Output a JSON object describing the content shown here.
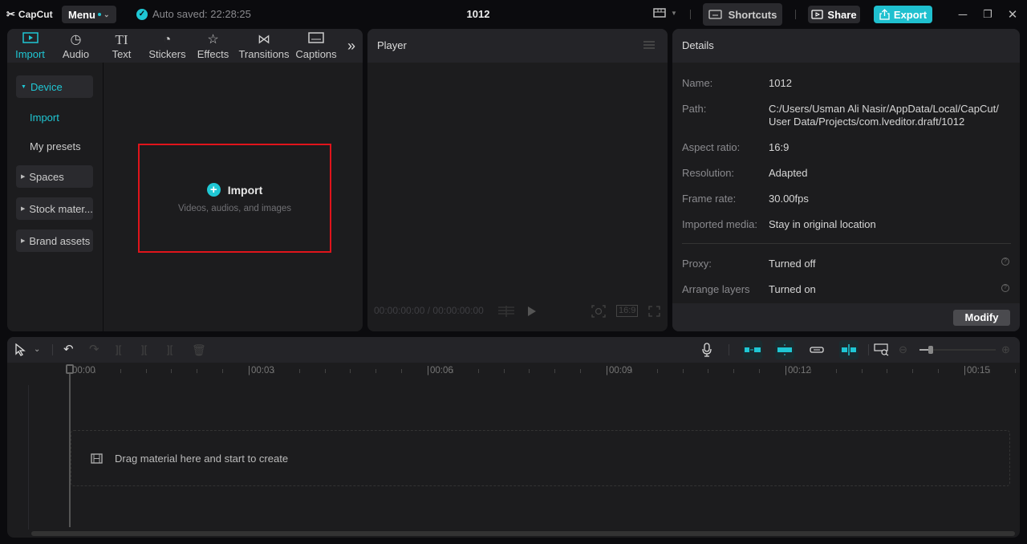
{
  "app": {
    "logo_text": "CapCut",
    "menu_label": "Menu",
    "autosave_text": "Auto saved: 22:28:25",
    "project_title": "1012",
    "shortcuts_label": "Shortcuts",
    "share_label": "Share",
    "export_label": "Export",
    "accent_color": "#1fc7d4"
  },
  "media_tabs": [
    {
      "label": "Import",
      "icon": "import-icon",
      "active": true
    },
    {
      "label": "Audio",
      "icon": "audio-icon"
    },
    {
      "label": "Text",
      "icon": "text-icon",
      "glyph": "TI"
    },
    {
      "label": "Stickers",
      "icon": "stickers-icon"
    },
    {
      "label": "Effects",
      "icon": "effects-icon"
    },
    {
      "label": "Transitions",
      "icon": "transitions-icon"
    },
    {
      "label": "Captions",
      "icon": "captions-icon"
    }
  ],
  "sidebar": {
    "device": "Device",
    "import": "Import",
    "my_presets": "My presets",
    "spaces": "Spaces",
    "stock": "Stock mater...",
    "brand": "Brand assets"
  },
  "import_box": {
    "title": "Import",
    "subtitle": "Videos, audios, and images"
  },
  "player": {
    "title": "Player",
    "time": "00:00:00:00 / 00:00:00:00",
    "ratio": "16:9"
  },
  "details": {
    "title": "Details",
    "rows": [
      {
        "label": "Name:",
        "value": "1012"
      },
      {
        "label": "Path:",
        "value": "C:/Users/Usman Ali Nasir/AppData/Local/CapCut/ User Data/Projects/com.lveditor.draft/1012"
      },
      {
        "label": "Aspect ratio:",
        "value": "16:9"
      },
      {
        "label": "Resolution:",
        "value": "Adapted"
      },
      {
        "label": "Frame rate:",
        "value": "30.00fps"
      },
      {
        "label": "Imported media:",
        "value": "Stay in original location"
      },
      {
        "label": "Proxy:",
        "value": "Turned off"
      },
      {
        "label": "Arrange layers",
        "value": "Turned on"
      }
    ],
    "modify_label": "Modify"
  },
  "timeline": {
    "ruler_labels": [
      "00:00",
      "00:03",
      "00:06",
      "00:09",
      "00:12",
      "00:15"
    ],
    "drop_text": "Drag material here and start to create",
    "zoom_level": 0.15
  }
}
